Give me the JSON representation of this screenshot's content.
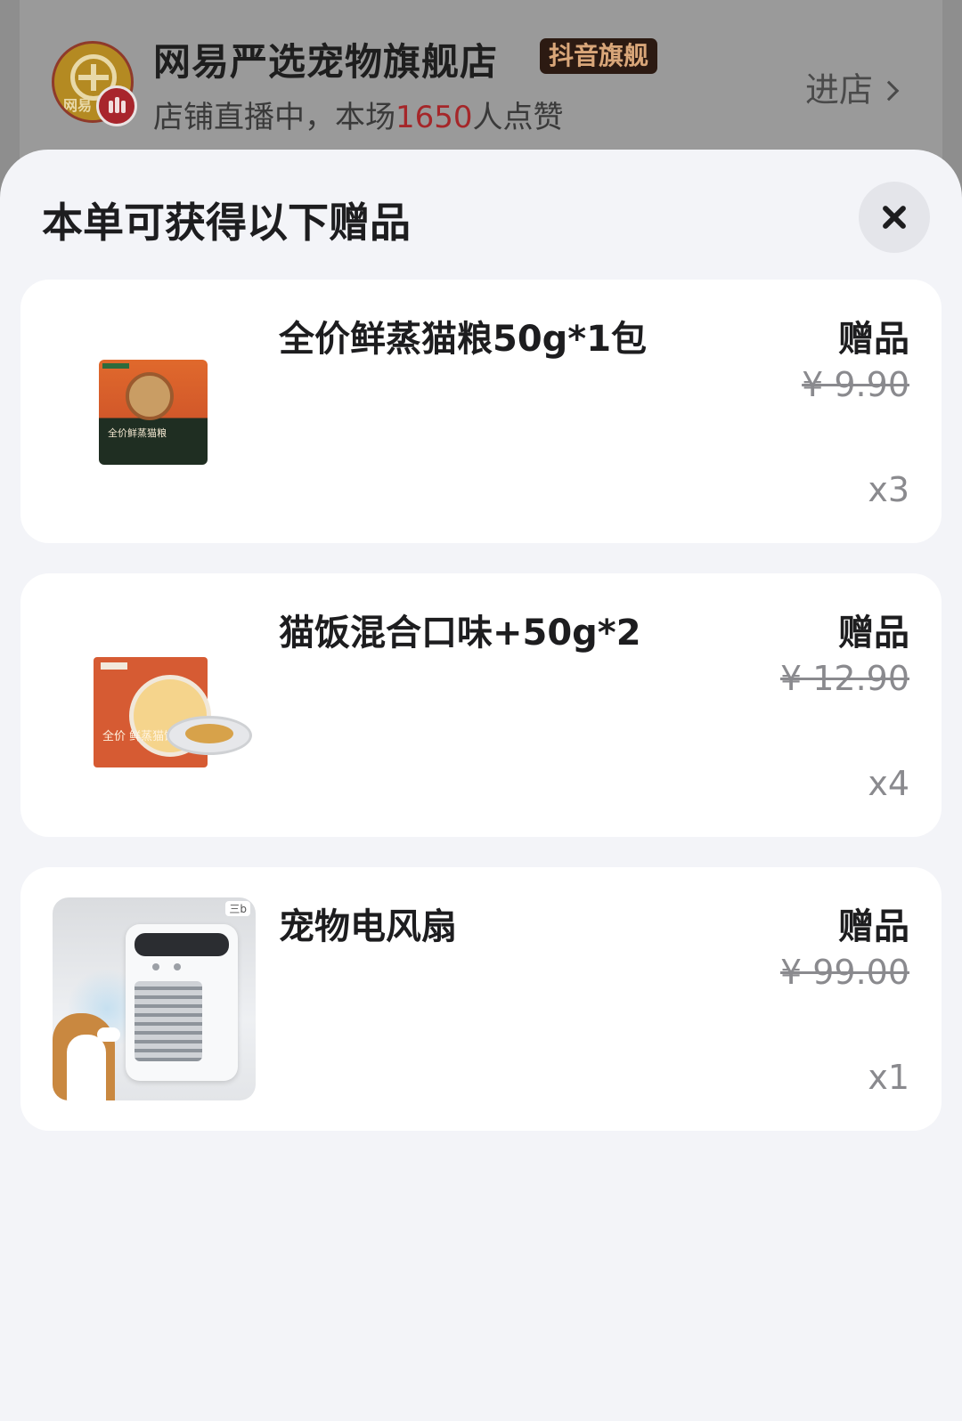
{
  "store": {
    "name": "网易严选宠物旗舰店",
    "tag": "抖音旗舰",
    "status_prefix": "店铺直播中，本场",
    "likes": "1650",
    "status_suffix": "人点赞",
    "enter_label": "进店",
    "logo_text": "网易"
  },
  "sheet": {
    "title": "本单可获得以下赠品"
  },
  "gifts": [
    {
      "name": "全价鲜蒸猫粮50g*1包",
      "tag": "赠品",
      "original_price": "¥ 9.90",
      "quantity": "x3",
      "image": "cat-food-pouch",
      "pack_label": "全价鲜蒸猫粮"
    },
    {
      "name": "猫饭混合口味+50g*2",
      "tag": "赠品",
      "original_price": "¥ 12.90",
      "quantity": "x4",
      "image": "cat-meal-box",
      "pack_label": "全价 鲜蒸猫饭"
    },
    {
      "name": "宠物电风扇",
      "tag": "赠品",
      "original_price": "¥ 99.00",
      "quantity": "x1",
      "image": "pet-fan-photo",
      "pack_label": "三b"
    }
  ],
  "colors": {
    "likes_red": "#a52629",
    "tag_bg": "#2c1a12",
    "tag_text": "#d9a679",
    "sheet_bg": "#f3f4f8",
    "card_bg": "#ffffff"
  }
}
